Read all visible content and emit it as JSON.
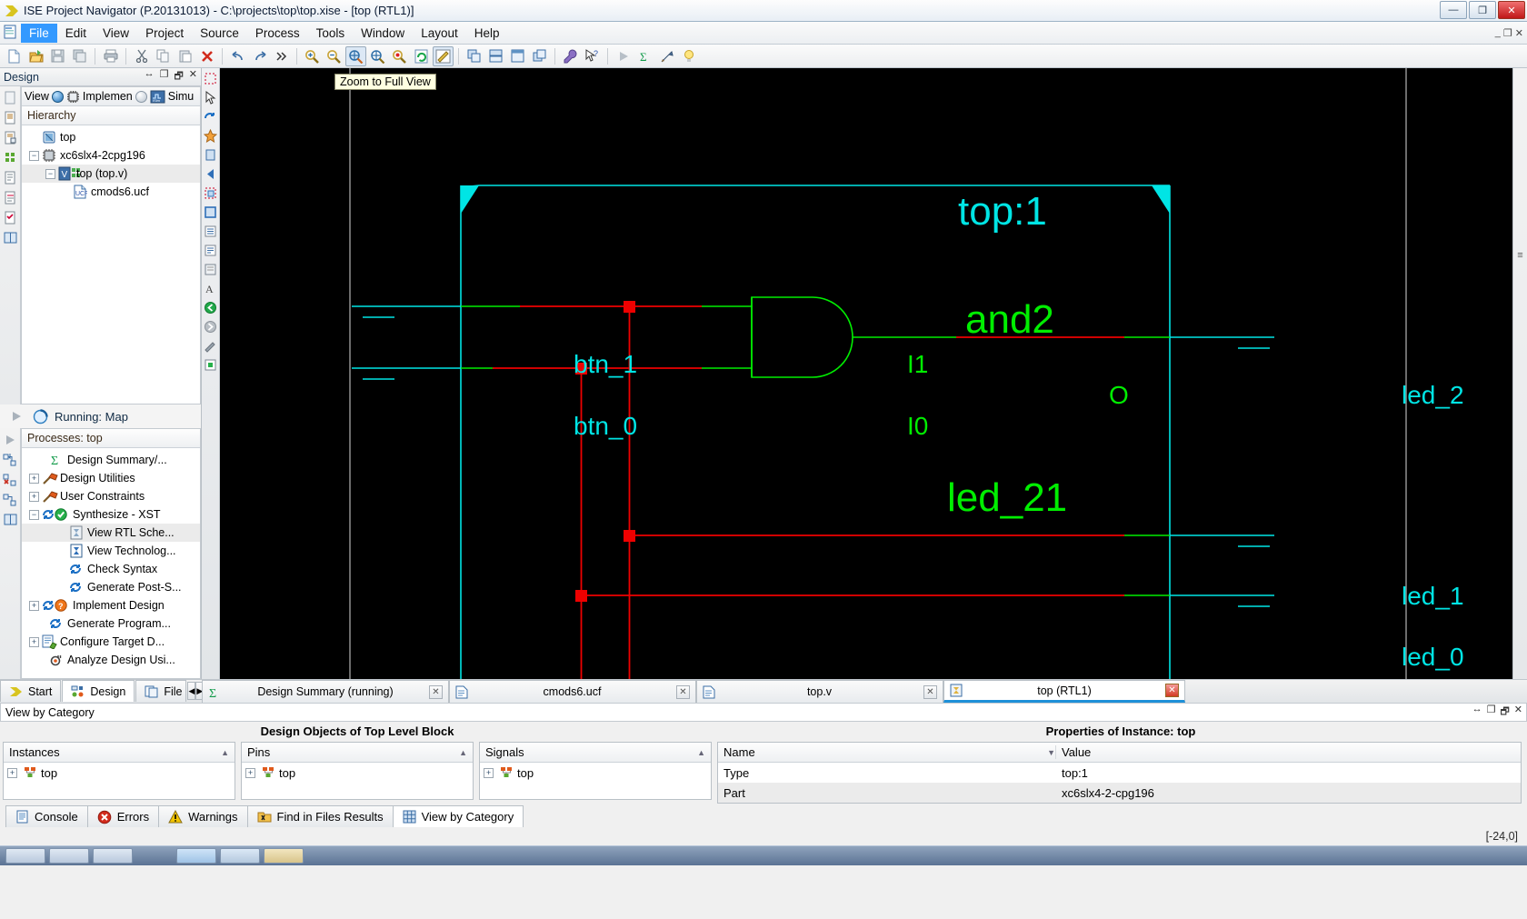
{
  "window": {
    "title": "ISE Project Navigator (P.20131013) - C:\\projects\\top\\top.xise - [top (RTL1)]",
    "icon": "ise-logo-icon",
    "minimize": "—",
    "maximize": "❐",
    "close": "✕",
    "inner_minimize": "_",
    "inner_restore": "❐",
    "inner_close": "✕"
  },
  "menu": {
    "items": [
      {
        "label": "File"
      },
      {
        "label": "Edit"
      },
      {
        "label": "View"
      },
      {
        "label": "Project"
      },
      {
        "label": "Source"
      },
      {
        "label": "Process"
      },
      {
        "label": "Tools"
      },
      {
        "label": "Window"
      },
      {
        "label": "Layout"
      },
      {
        "label": "Help"
      }
    ],
    "active_index": 0
  },
  "toolbar": {
    "buttons": [
      "new-file-icon",
      "open-file-icon",
      "save-icon",
      "save-all-icon",
      "print-icon",
      "cut-icon",
      "copy-icon",
      "paste-icon",
      "delete-icon",
      "undo-icon",
      "redo-icon",
      "overflow-chevron-icon",
      "zoom-in-icon",
      "zoom-out-icon",
      "zoom-full-view-icon",
      "zoom-to-box-icon",
      "zoom-selection-icon",
      "refresh-icon",
      "toggle-marker-icon",
      "tile-horizontal-icon",
      "tile-vertical-icon",
      "new-window-icon",
      "cascade-icon",
      "wrench-icon",
      "whats-this-icon",
      "run-icon",
      "summary-icon",
      "implement-icon",
      "hint-icon"
    ],
    "pressed": [
      "zoom-full-view-icon",
      "toggle-marker-icon"
    ]
  },
  "design_panel": {
    "title": "Design",
    "controls": [
      "↔",
      "❐",
      "🗗",
      "✕"
    ],
    "view_bar": {
      "label": "View",
      "options": [
        {
          "label": "Implementation",
          "display": "Implemen",
          "selected": true
        },
        {
          "label": "Simulation",
          "display": "Simu",
          "selected": false
        }
      ]
    },
    "hierarchy_header": "Hierarchy",
    "tree": [
      {
        "label": "top",
        "indent": 1,
        "icon": "project-icon",
        "expander": "none",
        "selected": false
      },
      {
        "label": "xc6slx4-2cpg196",
        "indent": 0,
        "icon": "chip-icon",
        "expander": "minus",
        "selected": false
      },
      {
        "label": "top (top.v)",
        "indent": 1,
        "icon": "verilog-module-icon",
        "expander": "minus",
        "selected": true
      },
      {
        "label": "cmods6.ucf",
        "indent": 2,
        "icon": "ucf-file-icon",
        "expander": "none",
        "selected": false
      }
    ]
  },
  "process_panel": {
    "running_label": "Running: Map",
    "running_icon": "progress-spinner-icon",
    "header": "Processes: top",
    "items": [
      {
        "label": "Design Summary/...",
        "indent": 1,
        "icon": "sigma-icon",
        "expander": "none",
        "selected": false
      },
      {
        "label": "Design Utilities",
        "indent": 0,
        "icon": "hammer-icon",
        "expander": "plus",
        "selected": false
      },
      {
        "label": "User Constraints",
        "indent": 0,
        "icon": "hammer-icon",
        "expander": "plus",
        "selected": false
      },
      {
        "label": "Synthesize - XST",
        "indent": 0,
        "icon": "process-ok-icon",
        "expander": "minus",
        "selected": false
      },
      {
        "label": "View RTL Sche...",
        "indent": 2,
        "icon": "rtl-schematic-icon",
        "expander": "none",
        "selected": true
      },
      {
        "label": "View Technolog...",
        "indent": 2,
        "icon": "tech-schematic-icon",
        "expander": "none",
        "selected": false
      },
      {
        "label": "Check Syntax",
        "indent": 2,
        "icon": "process-icon",
        "expander": "none",
        "selected": false
      },
      {
        "label": "Generate Post-S...",
        "indent": 2,
        "icon": "process-icon",
        "expander": "none",
        "selected": false
      },
      {
        "label": "Implement Design",
        "indent": 0,
        "icon": "process-warn-icon",
        "expander": "plus",
        "selected": false
      },
      {
        "label": "Generate Program...",
        "indent": 1,
        "icon": "process-icon",
        "expander": "none",
        "selected": false
      },
      {
        "label": "Configure Target D...",
        "indent": 0,
        "icon": "configure-icon",
        "expander": "plus",
        "selected": false
      },
      {
        "label": "Analyze Design Usi...",
        "indent": 1,
        "icon": "analyze-icon",
        "expander": "none",
        "selected": false
      }
    ]
  },
  "schematic": {
    "tooltip": "Zoom to Full View",
    "title": "top:1",
    "gate_label": "and2",
    "instance_label": "led_21",
    "output_pin": "O",
    "input_pins": [
      "I1",
      "I0"
    ],
    "inputs": [
      {
        "label": "btn_1"
      },
      {
        "label": "btn_0"
      }
    ],
    "outputs": [
      {
        "label": "led_2"
      },
      {
        "label": "led_1"
      },
      {
        "label": "led_0"
      }
    ],
    "colors": {
      "background": "#000000",
      "port": "#00e5e5",
      "wire_net": "#00ee00",
      "wire_selected": "#ee0000",
      "junction": "#ee0000"
    }
  },
  "side_tabs": [
    {
      "label": "Start",
      "icon": "start-arrow-icon",
      "active": false
    },
    {
      "label": "Design",
      "icon": "design-icon",
      "active": true
    },
    {
      "label": "File",
      "icon": "files-icon",
      "active": false
    }
  ],
  "doc_tabs": [
    {
      "label": "Design Summary (running)",
      "icon": "sigma-icon",
      "active": false,
      "close": "✕"
    },
    {
      "label": "cmods6.ucf",
      "icon": "text-file-icon",
      "active": false,
      "close": "✕"
    },
    {
      "label": "top.v",
      "icon": "text-file-icon",
      "active": false,
      "close": "✕"
    },
    {
      "label": "top (RTL1)",
      "icon": "rtl-schematic-icon",
      "active": true,
      "close": "✕"
    }
  ],
  "bottom_dock": {
    "view_by_category_label": "View by Category",
    "controls": [
      "↔",
      "❐",
      "🗗",
      "✕"
    ],
    "design_objects_title": "Design Objects of Top Level Block",
    "properties_title": "Properties of Instance: top",
    "lists": [
      {
        "header": "Instances",
        "rows": [
          {
            "label": "top",
            "icon": "instance-icon",
            "expander": "plus"
          }
        ]
      },
      {
        "header": "Pins",
        "rows": [
          {
            "label": "top",
            "icon": "pin-icon",
            "expander": "plus"
          }
        ]
      },
      {
        "header": "Signals",
        "rows": [
          {
            "label": "top",
            "icon": "pin-icon",
            "expander": "plus"
          }
        ]
      }
    ],
    "properties": {
      "columns": [
        "Name",
        "Value"
      ],
      "rows": [
        {
          "name": "Type",
          "value": "top:1"
        },
        {
          "name": "Part",
          "value": "xc6slx4-2-cpg196"
        }
      ]
    }
  },
  "status_tabs": [
    {
      "label": "Console",
      "icon": "console-icon",
      "active": false
    },
    {
      "label": "Errors",
      "icon": "error-icon",
      "active": false
    },
    {
      "label": "Warnings",
      "icon": "warning-icon",
      "active": false
    },
    {
      "label": "Find in Files Results",
      "icon": "find-files-icon",
      "active": false
    },
    {
      "label": "View by Category",
      "icon": "grid-icon",
      "active": true
    }
  ],
  "status_bar": {
    "coordinates": "[-24,0]"
  }
}
